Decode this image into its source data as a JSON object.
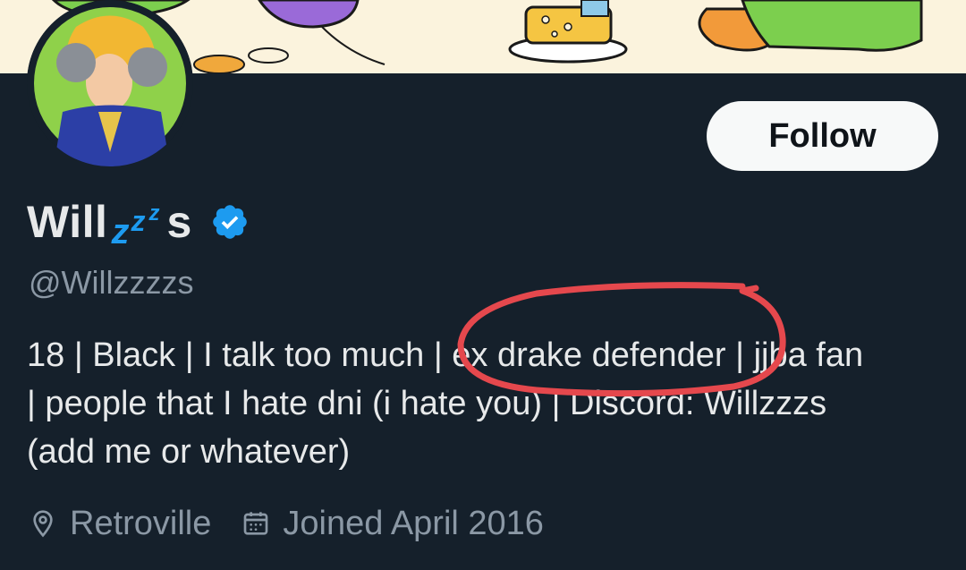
{
  "profile": {
    "display_name_prefix": "Will",
    "display_name_zzz": [
      "z",
      "z",
      "z"
    ],
    "display_name_suffix": "s",
    "handle": "@Willzzzzs",
    "follow_label": "Follow",
    "bio_lines": [
      "18 | Black | I talk too much | ex drake defender | jjba fan",
      "| people that I hate dni (i hate you) | Discord: Willzzzs",
      "(add me or whatever)"
    ],
    "location": "Retroville",
    "joined": "Joined April 2016"
  },
  "icons": {
    "verified": "verified-badge-icon",
    "location": "location-pin-icon",
    "calendar": "calendar-icon"
  },
  "colors": {
    "background": "#15202b",
    "verified": "#1d9bf0",
    "annotation": "#e5484d",
    "muted_text": "#8b98a5"
  }
}
